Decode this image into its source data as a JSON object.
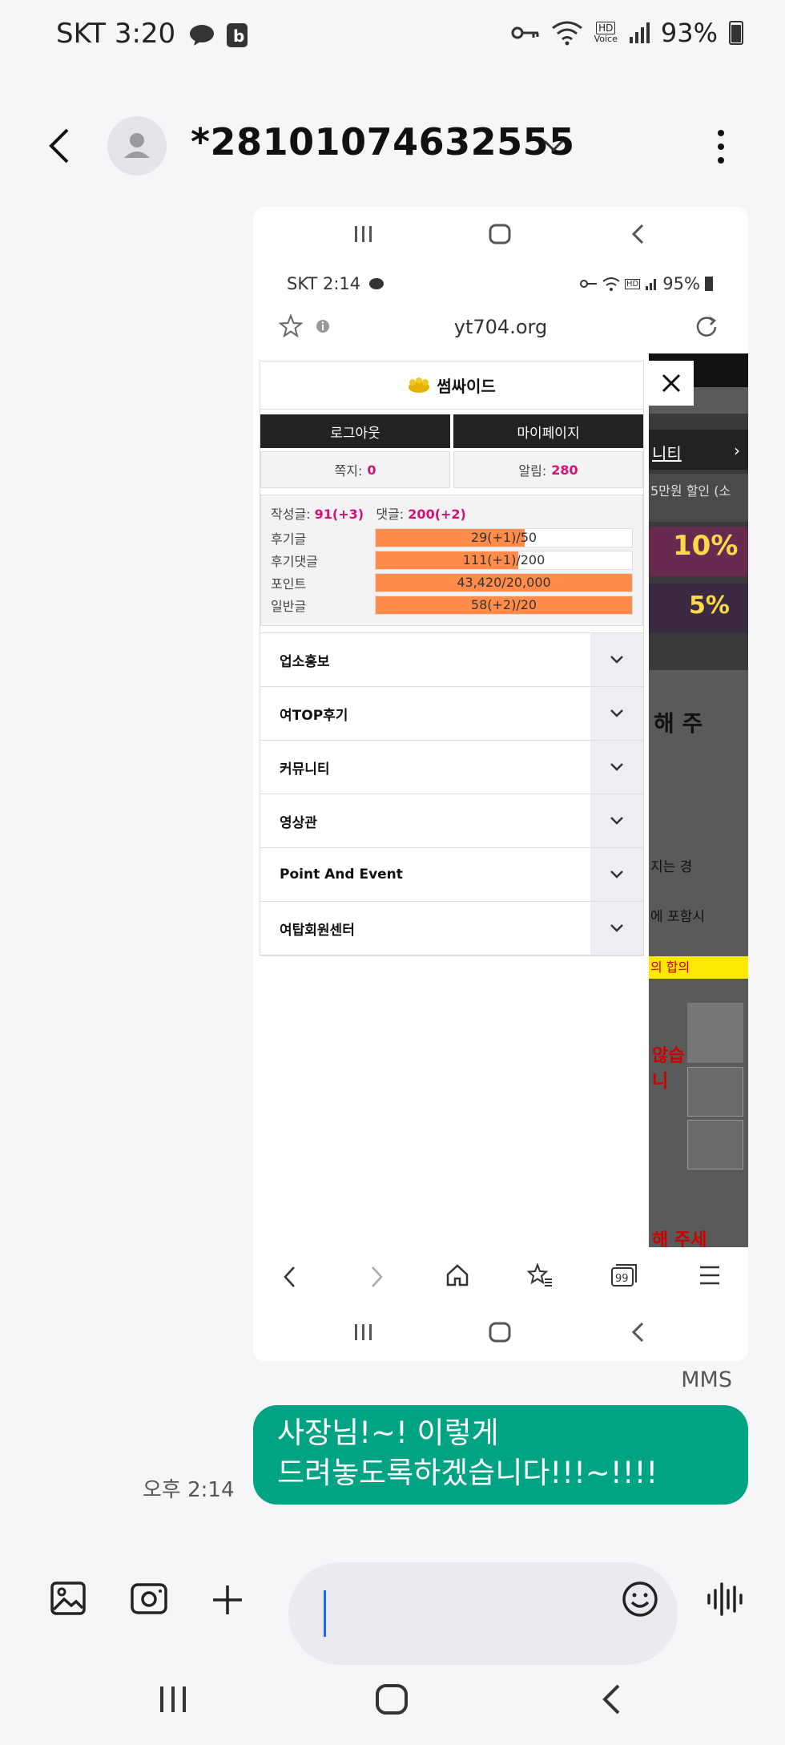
{
  "status_bar": {
    "carrier_time": "SKT 3:20",
    "hd": "HD",
    "voice": "Voice",
    "battery": "93%"
  },
  "header": {
    "contact": "*28101074632555"
  },
  "screenshot": {
    "status": {
      "carrier_time": "SKT 2:14",
      "hd": "HD",
      "battery": "95%"
    },
    "url": "yt704.org",
    "menu": {
      "site_name": "썸싸이드",
      "logout": "로그아웃",
      "mypage": "마이페이지",
      "note_label": "쪽지:",
      "note_count": "0",
      "alert_label": "알림:",
      "alert_count": "280",
      "post_label": "작성글:",
      "post_value": "91(+3)",
      "comment_label": "댓글:",
      "comment_value": "200(+2)",
      "progress": [
        {
          "label": "후기글",
          "value": "29(+1)/50",
          "fraction": 0.58
        },
        {
          "label": "후기댓글",
          "value": "111(+1)/200",
          "fraction": 0.555
        },
        {
          "label": "포인트",
          "value": "43,420/20,000",
          "fraction": 1.0
        },
        {
          "label": "일반글",
          "value": "58(+2)/20",
          "fraction": 1.0
        }
      ],
      "items": [
        "업소홍보",
        "여TOP후기",
        "커뮤니티",
        "영상관",
        "Point And Event",
        "여탑회원센터"
      ]
    },
    "bg_text": {
      "nav": "니티",
      "promo": "5만원 할인 (소",
      "pct1": "10%",
      "pct2": "5%",
      "heading": "해 주",
      "line1": "지는 경",
      "line2": "에 포함시",
      "line3": "의 합의",
      "red1": "않습니",
      "red2": "해 주세"
    }
  },
  "message": {
    "type_label": "MMS",
    "line1": "사장님!~! 이렇게",
    "line2": "드려놓도록하겠습니다!!!~!!!!",
    "time": "오후 2:14"
  },
  "colors": {
    "bubble": "#00a383",
    "accent_orange": "#ff8c4a",
    "pink": "#d1107a"
  }
}
